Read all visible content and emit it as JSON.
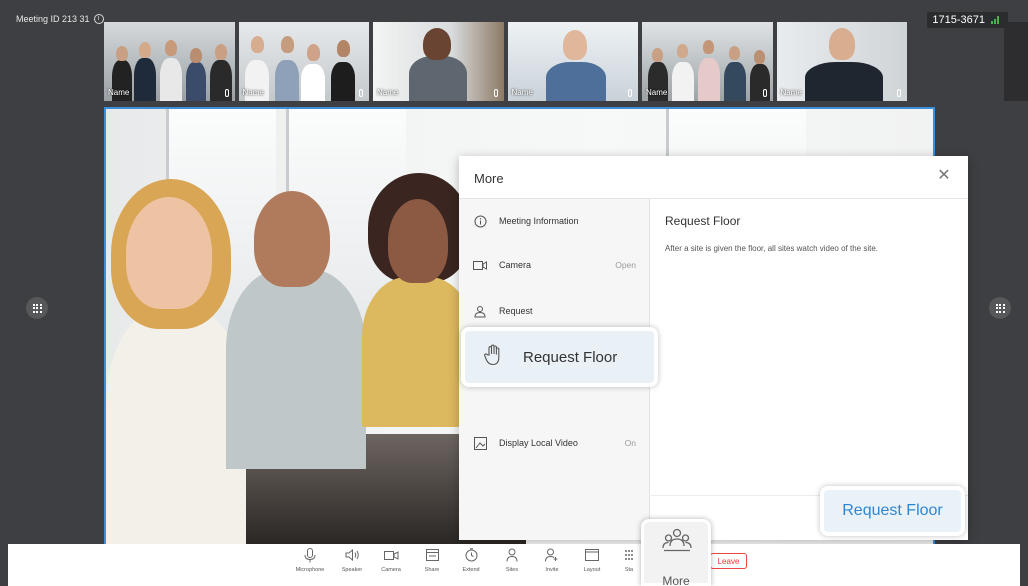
{
  "header": {
    "meeting_id": "Meeting ID 213 31",
    "number_badge": "1715-3671",
    "signal_label": ".ıl"
  },
  "thumbnails": [
    {
      "label": "Name"
    },
    {
      "label": "Name"
    },
    {
      "label": "Name"
    },
    {
      "label": "Name"
    },
    {
      "label": "Name"
    },
    {
      "label": "Name"
    }
  ],
  "more_panel": {
    "title": "More",
    "close_icon": "close-icon",
    "menu": [
      {
        "icon": "info-icon",
        "label": "Meeting Information",
        "value": ""
      },
      {
        "icon": "camera-icon",
        "label": "Camera",
        "value": "Open"
      },
      {
        "icon": "request-icon",
        "label": "Request",
        "value": ""
      },
      {
        "icon": "hand-icon",
        "label": "Request Floor",
        "value": ""
      },
      {
        "icon": "image-icon",
        "label": "Display Local Video",
        "value": "On"
      }
    ],
    "detail_title": "Request Floor",
    "detail_desc": "After a site is given the floor, all sites watch video of the site.",
    "action_button": "Request Floor"
  },
  "toolbar": {
    "items": [
      {
        "icon": "microphone-icon",
        "label": "Microphone"
      },
      {
        "icon": "speaker-icon",
        "label": "Speaker"
      },
      {
        "icon": "camera-icon",
        "label": "Camera"
      },
      {
        "icon": "share-icon",
        "label": "Share"
      },
      {
        "icon": "clock-icon",
        "label": "Extend"
      },
      {
        "icon": "person-icon",
        "label": "Sites"
      },
      {
        "icon": "invite-icon",
        "label": "Invite"
      },
      {
        "icon": "layout-icon",
        "label": "Layout"
      },
      {
        "icon": "dialpad-icon",
        "label": "Sta"
      }
    ],
    "more_label": "More",
    "leave_label": "Leave"
  },
  "colors": {
    "accent": "#2f86d0",
    "background": "#3e3f42",
    "leave": "#e33333"
  }
}
